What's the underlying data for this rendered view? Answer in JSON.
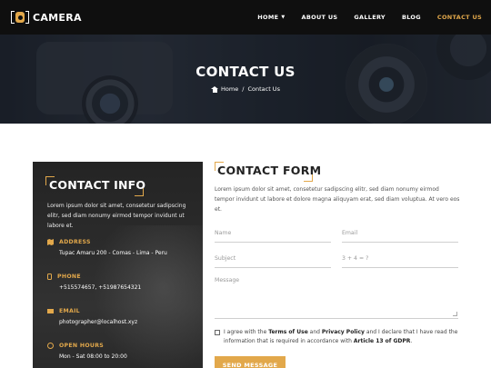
{
  "brand": {
    "name": "CAMERA"
  },
  "nav": {
    "items": [
      {
        "label": "HOME",
        "has_dropdown": true,
        "active": false
      },
      {
        "label": "ABOUT US",
        "active": false
      },
      {
        "label": "GALLERY",
        "active": false
      },
      {
        "label": "BLOG",
        "active": false
      },
      {
        "label": "CONTACT US",
        "active": true
      }
    ]
  },
  "hero": {
    "title": "CONTACT US",
    "breadcrumb": {
      "home": "Home",
      "separator": "/",
      "current": "Contact Us"
    }
  },
  "info": {
    "title": "CONTACT INFO",
    "description": "Lorem ipsum dolor sit amet, consetetur sadipscing elitr, sed diam nonumy eirmod tempor invidunt ut labore et.",
    "address": {
      "label": "ADDRESS",
      "value": "Tupac Amaru 200 - Comas - Lima - Peru"
    },
    "phone": {
      "label": "PHONE",
      "value": "+515574657, +51987654321"
    },
    "email": {
      "label": "EMAIL",
      "value": "photographer@localhost.xyz"
    },
    "hours": {
      "label": "OPEN HOURS",
      "value": "Mon - Sat 08:00 to 20:00"
    }
  },
  "form": {
    "title": "CONTACT FORM",
    "description": "Lorem ipsum dolor sit amet, consetetur sadipscing elitr, sed diam nonumy eirmod tempor invidunt ut labore et dolore magna aliquyam erat, sed diam voluptua. At vero eos et.",
    "name_placeholder": "Name",
    "email_placeholder": "Email",
    "subject_placeholder": "Subject",
    "captcha_placeholder": "3 + 4 = ?",
    "message_placeholder": "Message",
    "agree": {
      "prefix": "I agree with the ",
      "terms": "Terms of Use",
      "and": " and ",
      "privacy": "Privacy Policy",
      "middle": " and I declare that I have read the information that is required in accordance with ",
      "article": "Article 13 of GDPR",
      "suffix": "."
    },
    "send_label": "SEND MESSAGE"
  },
  "colors": {
    "accent": "#e2a84b",
    "nav_bg": "#0f0f0f",
    "panel_bg": "#2a2a2a"
  }
}
